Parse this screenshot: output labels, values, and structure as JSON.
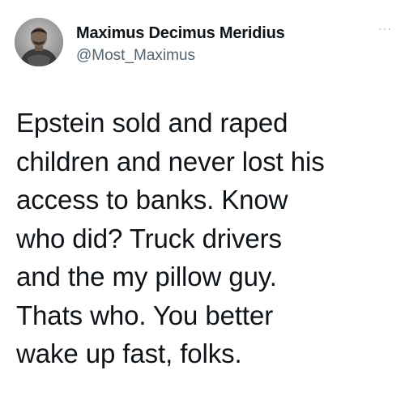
{
  "author": {
    "display_name": "Maximus Decimus Meridius",
    "handle": "@Most_Maximus",
    "avatar_icon": "user-avatar",
    "more_icon": "more-options-icon",
    "more_glyph": "···"
  },
  "tweet": {
    "lines": [
      "Epstein sold and raped",
      "children and never lost his",
      "access to banks. Know",
      "who did? Truck drivers",
      "and the my pillow guy.",
      "Thats who. You better",
      "wake up fast, folks."
    ]
  },
  "colors": {
    "text": "#0f1419",
    "secondary": "#536471",
    "background": "#ffffff"
  }
}
